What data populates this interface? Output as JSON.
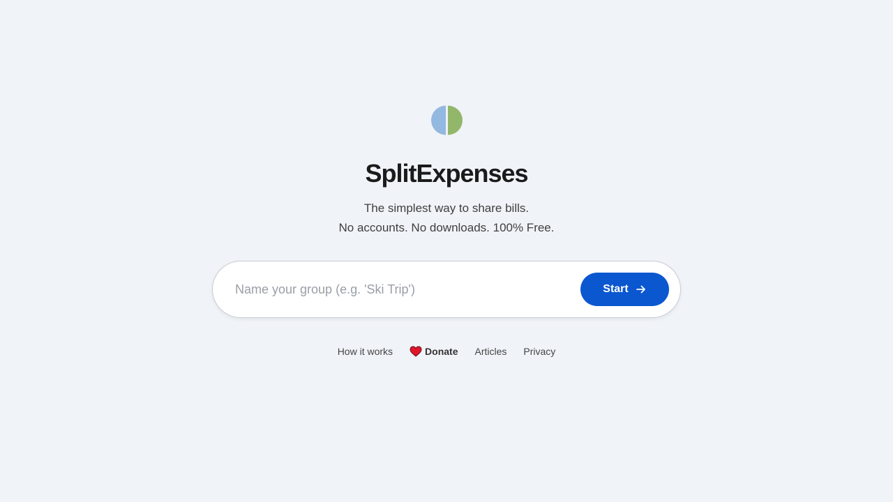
{
  "brand": {
    "name": "SplitExpenses",
    "logo_icon": "split-circle-icon",
    "logo_colors": {
      "left": "#93b9e0",
      "right": "#92b76a"
    }
  },
  "tagline": {
    "line1": "The simplest way to share bills.",
    "line2": "No accounts. No downloads. 100% Free."
  },
  "group_form": {
    "input_value": "",
    "input_placeholder": "Name your group (e.g. 'Ski Trip')",
    "start_label": "Start",
    "start_icon": "arrow-right-icon",
    "accent_color": "#0b57d0"
  },
  "footer": {
    "links": [
      {
        "label": "How it works"
      },
      {
        "label": "Donate",
        "icon": "heart-icon",
        "icon_color": "#e0162b"
      },
      {
        "label": "Articles"
      },
      {
        "label": "Privacy"
      }
    ]
  }
}
